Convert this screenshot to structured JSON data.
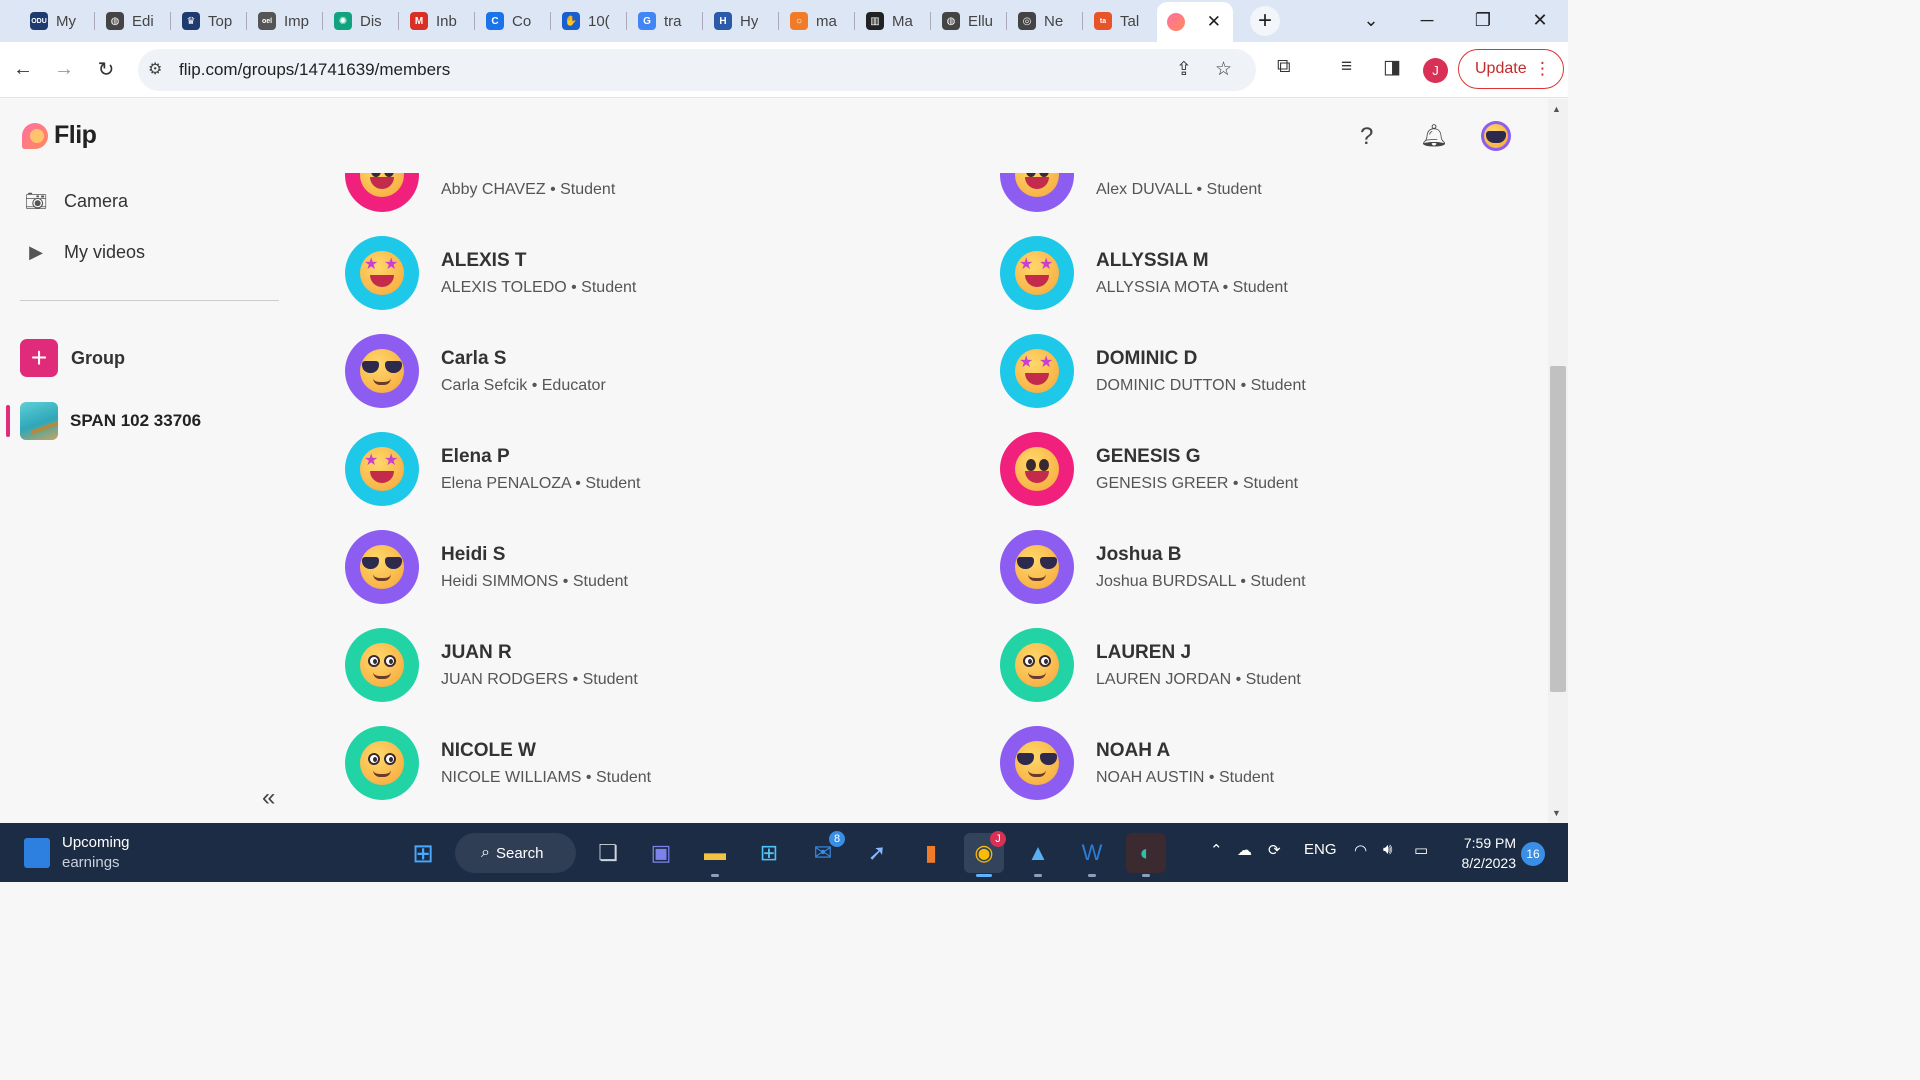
{
  "browser": {
    "tabs": [
      {
        "label": "My",
        "favicon": "odu-icon",
        "color": "#1f3a6e",
        "glyph": "ODU"
      },
      {
        "label": "Edi",
        "favicon": "globe-icon",
        "color": "#444",
        "glyph": "◍"
      },
      {
        "label": "Top",
        "favicon": "crown-icon",
        "color": "#1f3a6e",
        "glyph": "♛"
      },
      {
        "label": "Imp",
        "favicon": "oel-icon",
        "color": "#555",
        "glyph": "oel"
      },
      {
        "label": "Dis",
        "favicon": "chatgpt-icon",
        "color": "#10a37f",
        "glyph": "✺"
      },
      {
        "label": "Inb",
        "favicon": "gmail-icon",
        "color": "#d93025",
        "glyph": "M"
      },
      {
        "label": "Co",
        "favicon": "c-icon",
        "color": "#1a73e8",
        "glyph": "C"
      },
      {
        "label": "10(",
        "favicon": "hand-icon",
        "color": "#1a5fd0",
        "glyph": "✋"
      },
      {
        "label": "tra",
        "favicon": "google-icon",
        "color": "#4285f4",
        "glyph": "G"
      },
      {
        "label": "Hy",
        "favicon": "h-icon",
        "color": "#2a5aa8",
        "glyph": "H"
      },
      {
        "label": "ma",
        "favicon": "circle-icon",
        "color": "#f07c2a",
        "glyph": "○"
      },
      {
        "label": "Ma",
        "favicon": "odu-crest-icon",
        "color": "#222",
        "glyph": "▥"
      },
      {
        "label": "Ellu",
        "favicon": "globe-icon",
        "color": "#444",
        "glyph": "◍"
      },
      {
        "label": "Ne",
        "favicon": "circle-o-icon",
        "color": "#444",
        "glyph": "◎"
      },
      {
        "label": "Tal",
        "favicon": "ta-icon",
        "color": "#e8532a",
        "glyph": "ta"
      }
    ],
    "active_tab": {
      "favicon": "flip-icon",
      "close": "✕"
    },
    "new_tab": "+",
    "url": "flip.com/groups/14741639/members",
    "profile_initial": "J",
    "update_label": "Update"
  },
  "app": {
    "name": "Flip",
    "sidebar": {
      "camera_label": "Camera",
      "my_videos_label": "My videos",
      "group_button_label": "Group",
      "group_name": "SPAN 102 33706"
    }
  },
  "members": [
    {
      "display": "",
      "full": "Abby CHAVEZ • Student",
      "avatar": "pink",
      "face": "grin",
      "col": 0,
      "row": -1
    },
    {
      "display": "",
      "full": "Alex DUVALL • Student",
      "avatar": "purple",
      "face": "grin",
      "col": 1,
      "row": -1
    },
    {
      "display": "ALEXIS T",
      "full": "ALEXIS TOLEDO • Student",
      "avatar": "cyan",
      "face": "stars",
      "col": 0,
      "row": 0
    },
    {
      "display": "ALLYSSIA M",
      "full": "ALLYSSIA MOTA • Student",
      "avatar": "cyan",
      "face": "stars",
      "col": 1,
      "row": 0
    },
    {
      "display": "Carla S",
      "full": "Carla Sefcik • Educator",
      "avatar": "purple",
      "face": "sunglasses",
      "col": 0,
      "row": 1
    },
    {
      "display": "DOMINIC D",
      "full": "DOMINIC DUTTON • Student",
      "avatar": "cyan",
      "face": "stars",
      "col": 1,
      "row": 1
    },
    {
      "display": "Elena P",
      "full": "Elena PENALOZA • Student",
      "avatar": "cyan",
      "face": "stars",
      "col": 0,
      "row": 2
    },
    {
      "display": "GENESIS G",
      "full": "GENESIS GREER • Student",
      "avatar": "pink",
      "face": "grin",
      "col": 1,
      "row": 2
    },
    {
      "display": "Heidi S",
      "full": "Heidi SIMMONS • Student",
      "avatar": "purple",
      "face": "sunglasses",
      "col": 0,
      "row": 3
    },
    {
      "display": "Joshua B",
      "full": "Joshua BURDSALL • Student",
      "avatar": "purple",
      "face": "sunglasses",
      "col": 1,
      "row": 3
    },
    {
      "display": "JUAN R",
      "full": "JUAN RODGERS • Student",
      "avatar": "green",
      "face": "googly",
      "col": 0,
      "row": 4
    },
    {
      "display": "LAUREN J",
      "full": "LAUREN JORDAN • Student",
      "avatar": "green",
      "face": "googly",
      "col": 1,
      "row": 4
    },
    {
      "display": "NICOLE W",
      "full": "NICOLE WILLIAMS • Student",
      "avatar": "green",
      "face": "googly",
      "col": 0,
      "row": 5
    },
    {
      "display": "NOAH A",
      "full": "NOAH AUSTIN • Student",
      "avatar": "purple",
      "face": "sunglasses",
      "col": 1,
      "row": 5
    }
  ],
  "avatar_colors": {
    "pink": "#f0207c",
    "purple": "#8d5cf0",
    "cyan": "#1ec8e8",
    "green": "#22d3a5"
  },
  "taskbar": {
    "weather_title": "Upcoming",
    "weather_sub": "earnings",
    "search_label": "Search",
    "mail_badge": "8",
    "chrome_badge": "J",
    "language": "ENG",
    "time": "7:59 PM",
    "date": "8/2/2023",
    "notifications": "16"
  }
}
